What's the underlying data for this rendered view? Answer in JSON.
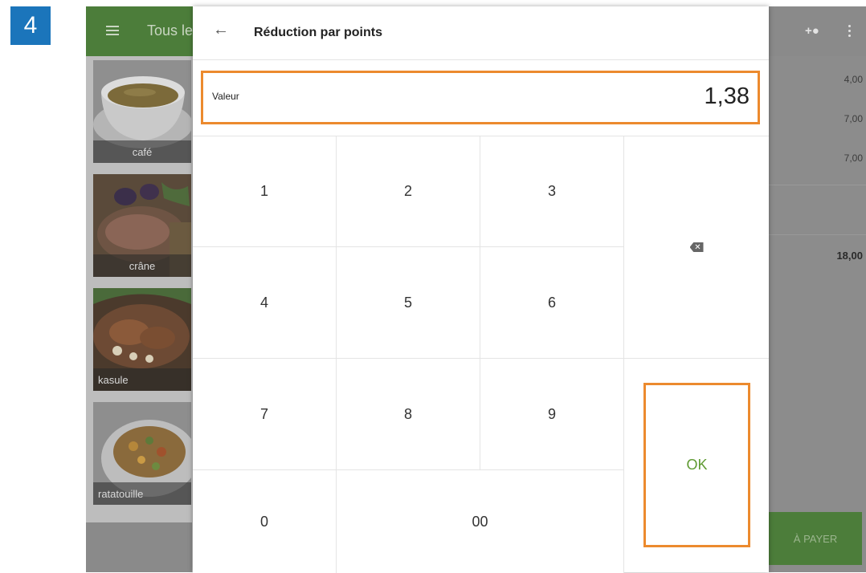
{
  "step": "4",
  "appbar": {
    "category_title": "Tous les",
    "menu_icon": "menu-icon",
    "add_customer_icon": "add-person-icon",
    "more_icon": "more-vert-icon"
  },
  "products": [
    {
      "label": "café"
    },
    {
      "label": "crâne"
    },
    {
      "label": "kasule"
    },
    {
      "label": "ratatouille"
    }
  ],
  "order": {
    "lines": [
      "4,00",
      "7,00",
      "7,00"
    ],
    "total": "18,00",
    "pay_label": "À PAYER"
  },
  "dialog": {
    "title": "Réduction par points",
    "back_icon": "arrow-back-icon",
    "field_label": "Valeur",
    "field_value": "1,38"
  },
  "keypad": {
    "k1": "1",
    "k2": "2",
    "k3": "3",
    "k4": "4",
    "k5": "5",
    "k6": "6",
    "k7": "7",
    "k8": "8",
    "k9": "9",
    "k0": "0",
    "k00": "00",
    "backspace_icon": "backspace-icon",
    "ok": "OK"
  },
  "colors": {
    "accent_orange": "#ec8a2e",
    "brand_green": "#4c7d3a",
    "ok_green": "#5f9a32",
    "badge_blue": "#1b75bb"
  }
}
